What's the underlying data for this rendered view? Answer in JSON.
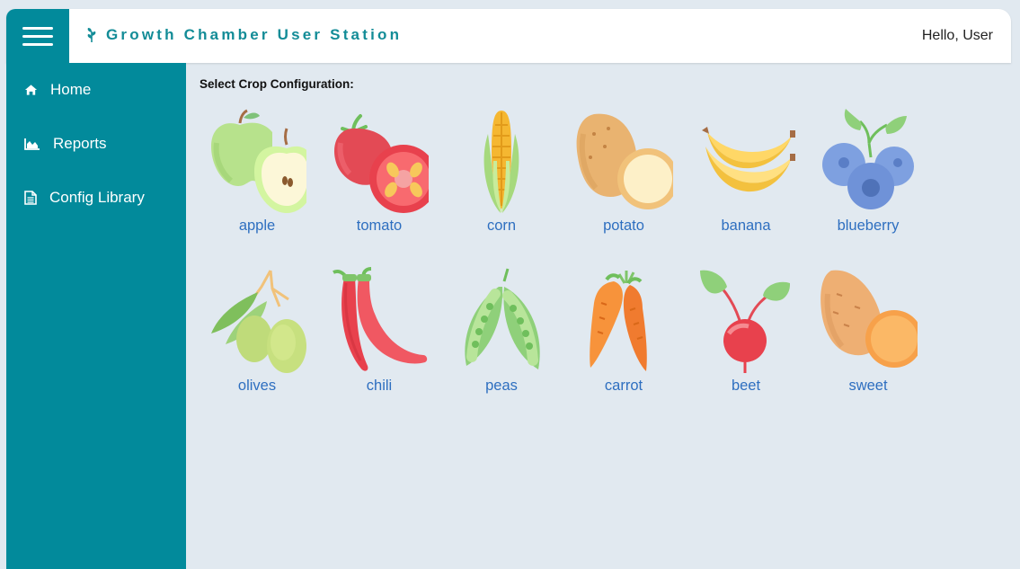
{
  "header": {
    "title": "Growth Chamber User Station",
    "greeting": "Hello, User"
  },
  "sidebar": {
    "items": [
      {
        "label": "Home",
        "icon": "home-icon"
      },
      {
        "label": "Reports",
        "icon": "area-chart-icon"
      },
      {
        "label": "Config Library",
        "icon": "document-icon"
      }
    ]
  },
  "main": {
    "title": "Select Crop Configuration:",
    "crops": [
      {
        "label": "apple",
        "icon": "apple-icon"
      },
      {
        "label": "tomato",
        "icon": "tomato-icon"
      },
      {
        "label": "corn",
        "icon": "corn-icon"
      },
      {
        "label": "potato",
        "icon": "potato-icon"
      },
      {
        "label": "banana",
        "icon": "banana-icon"
      },
      {
        "label": "blueberry",
        "icon": "blueberry-icon"
      },
      {
        "label": "olives",
        "icon": "olives-icon"
      },
      {
        "label": "chili",
        "icon": "chili-icon"
      },
      {
        "label": "peas",
        "icon": "peas-icon"
      },
      {
        "label": "carrot",
        "icon": "carrot-icon"
      },
      {
        "label": "beet",
        "icon": "beet-icon"
      },
      {
        "label": "sweet",
        "icon": "sweet-potato-icon"
      }
    ]
  },
  "colors": {
    "accent": "#028a9b",
    "brand_text": "#138c97",
    "link": "#2e6fc0",
    "background": "#e1e9f0"
  }
}
